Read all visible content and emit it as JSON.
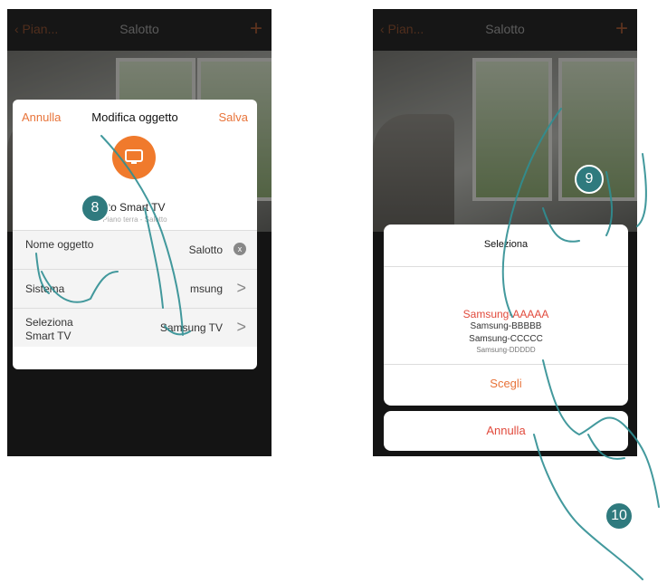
{
  "left": {
    "topbar": {
      "back": "‹ Pian...",
      "title": "Salotto",
      "plus": "+"
    },
    "card": {
      "cancel": "Annulla",
      "title": "Modifica oggetto",
      "save": "Salva",
      "object_name": "tto Smart TV",
      "object_sub": "Piano terra - Salotto",
      "rows": [
        {
          "label": "Nome oggetto",
          "value": "Salotto",
          "control": "x"
        },
        {
          "label": "Sistema",
          "value": "msung",
          "control": "chevron"
        },
        {
          "label": "Seleziona Smart TV",
          "value": "Samsung TV",
          "control": "chevron"
        }
      ]
    },
    "step": "8"
  },
  "right": {
    "topbar": {
      "back": "‹ Pian...",
      "title": "Salotto",
      "plus": "+"
    },
    "picker": {
      "title": "Seleziona",
      "options": [
        "Samsung-AAAAA",
        "Samsung-BBBBB",
        "Samsung-CCCCC",
        "Samsung-DDDDD"
      ],
      "selected_index": 0,
      "choose": "Scegli"
    },
    "cancel": "Annulla",
    "steps": [
      "9",
      "10"
    ]
  },
  "colors": {
    "accent": "#e8743a",
    "selected": "#e14a3c",
    "badge": "#2f7a7e",
    "icon": "#f07a2c"
  }
}
